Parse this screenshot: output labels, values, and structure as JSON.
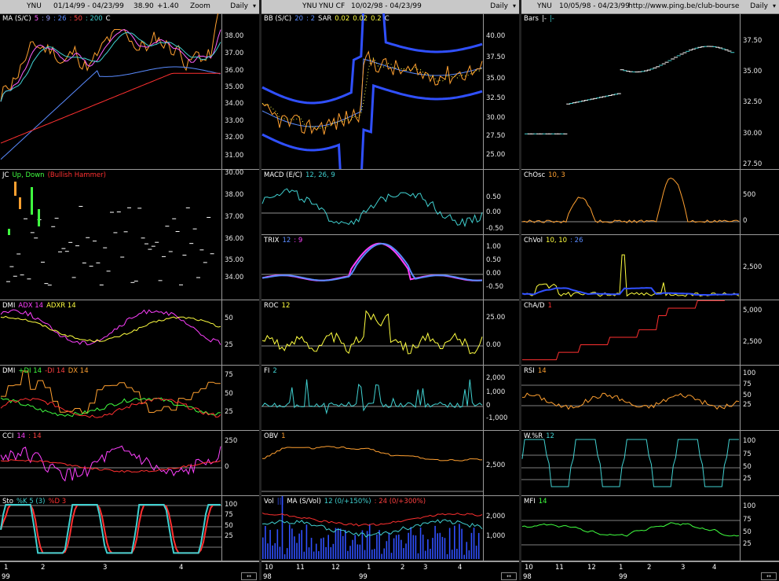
{
  "columns": [
    {
      "header": {
        "ticker": "YNU",
        "range": "01/14/99 - 04/23/99",
        "last": "38.90",
        "change": "+1.40",
        "zoom": "Zoom",
        "period": "Daily"
      },
      "panels": [
        {
          "label": [
            {
              "t": "MA (S/C)",
              "c": "#ffffff"
            },
            {
              "t": "5",
              "c": "#ff60ff"
            },
            {
              "t": ": 9",
              "c": "#9aa0ff"
            },
            {
              "t": ": 26",
              "c": "#5a8bff"
            },
            {
              "t": ": 50",
              "c": "#ff4040"
            },
            {
              "t": ": 200",
              "c": "#40d0d0"
            },
            {
              "t": "C",
              "c": "#ffffff"
            }
          ],
          "ticks": [
            "38.00",
            "37.00",
            "36.00",
            "35.00",
            "34.00",
            "33.00",
            "32.00",
            "31.00",
            "30.00"
          ]
        },
        {
          "label": [
            {
              "t": "JC",
              "c": "#ffffff"
            },
            {
              "t": "Up, Down",
              "c": "#40ff40"
            },
            {
              "t": "(Bullish Hammer)",
              "c": "#ff3030"
            }
          ],
          "ticks": [
            "38.00",
            "37.00",
            "36.00",
            "35.00",
            "34.00"
          ]
        },
        {
          "label": [
            {
              "t": "DMI",
              "c": "#ffffff"
            },
            {
              "t": "ADX 14",
              "c": "#ff40ff"
            },
            {
              "t": "ADXR 14",
              "c": "#ffff40"
            }
          ],
          "ticks": [
            "50",
            "25"
          ]
        },
        {
          "label": [
            {
              "t": "DMI",
              "c": "#ffffff"
            },
            {
              "t": "+DI 14",
              "c": "#40ff40"
            },
            {
              "t": "-DI 14",
              "c": "#ff4040"
            },
            {
              "t": "DX 14",
              "c": "#ffa030"
            }
          ],
          "ticks": [
            "75",
            "50",
            "25"
          ]
        },
        {
          "label": [
            {
              "t": "CCI",
              "c": "#ffffff"
            },
            {
              "t": "14",
              "c": "#ff40ff"
            },
            {
              "t": ": 14",
              "c": "#ff4040"
            }
          ],
          "ticks": [
            "250",
            "0"
          ]
        },
        {
          "label": [
            {
              "t": "Sto",
              "c": "#ffffff"
            },
            {
              "t": "%K 5 (3)",
              "c": "#40d0d0"
            },
            {
              "t": "%D 3",
              "c": "#ff3030"
            }
          ],
          "ticks": [
            "100",
            "75",
            "50",
            "25"
          ]
        }
      ],
      "xaxis": {
        "ticks": [
          "1",
          "2",
          "3",
          "4"
        ],
        "year": "99"
      }
    },
    {
      "header": {
        "ticker": "YNU",
        "sub": "YNU CF",
        "range": "10/02/98 - 04/23/99",
        "period": "Daily"
      },
      "panels": [
        {
          "label": [
            {
              "t": "BB (S/C)",
              "c": "#ffffff"
            },
            {
              "t": "20",
              "c": "#5a8bff"
            },
            {
              "t": ": 2",
              "c": "#5a8bff"
            },
            {
              "t": "SAR",
              "c": "#ffffff"
            },
            {
              "t": "0.02",
              "c": "#ffff40"
            },
            {
              "t": "0.02",
              "c": "#ffff40"
            },
            {
              "t": "0.2",
              "c": "#ffff40"
            },
            {
              "t": "C",
              "c": "#ffffff"
            }
          ],
          "ticks": [
            "40.00",
            "37.50",
            "35.00",
            "32.50",
            "30.00",
            "27.50",
            "25.00"
          ]
        },
        {
          "label": [
            {
              "t": "MACD (E/C)",
              "c": "#ffffff"
            },
            {
              "t": "12, 26, 9",
              "c": "#40d0d0"
            }
          ],
          "ticks": [
            "0.50",
            "0.00",
            "-0.50"
          ]
        },
        {
          "label": [
            {
              "t": "TRIX",
              "c": "#ffffff"
            },
            {
              "t": "12",
              "c": "#5a8bff"
            },
            {
              "t": ": 9",
              "c": "#ff40ff"
            }
          ],
          "ticks": [
            "1.00",
            "0.50",
            "0.00",
            "-0.50"
          ]
        },
        {
          "label": [
            {
              "t": "ROC",
              "c": "#ffffff"
            },
            {
              "t": "12",
              "c": "#ffff40"
            }
          ],
          "ticks": [
            "25.00",
            "0.00"
          ]
        },
        {
          "label": [
            {
              "t": "FI",
              "c": "#ffffff"
            },
            {
              "t": "2",
              "c": "#40d0d0"
            }
          ],
          "ticks": [
            "2,000",
            "1,000",
            "0",
            "-1,000"
          ]
        },
        {
          "label": [
            {
              "t": "OBV",
              "c": "#ffffff"
            },
            {
              "t": "1",
              "c": "#ffa030"
            }
          ],
          "ticks": [
            "2,500"
          ]
        },
        {
          "label": [
            {
              "t": "Vol",
              "c": "#ffffff"
            },
            {
              "t": "|||",
              "c": "#3050ff"
            },
            {
              "t": "MA (S/Vol)",
              "c": "#ffffff"
            },
            {
              "t": "12 (0/+150%)",
              "c": "#40d0d0"
            },
            {
              "t": ": 24 (0/+300%)",
              "c": "#ff4040"
            }
          ],
          "ticks": [
            "2,000",
            "1,000"
          ]
        }
      ],
      "xaxis": {
        "ticks": [
          "10",
          "11",
          "12",
          "1",
          "2",
          "3",
          "4"
        ],
        "year98": "98",
        "year99": "99"
      }
    },
    {
      "header": {
        "ticker": "YNU",
        "range": "10/05/98 - 04/23/99",
        "url": "http://www.ping.be/club-bourse",
        "period": "Daily"
      },
      "panels": [
        {
          "label": [
            {
              "t": "Bars",
              "c": "#ffffff"
            },
            {
              "t": "|-",
              "c": "#ffffff"
            },
            {
              "t": "|-",
              "c": "#40d0d0"
            }
          ],
          "ticks": [
            "37.50",
            "35.00",
            "32.50",
            "30.00",
            "27.50"
          ]
        },
        {
          "label": [
            {
              "t": "ChOsc",
              "c": "#ffffff"
            },
            {
              "t": "10, 3",
              "c": "#ffa030"
            }
          ],
          "ticks": [
            "500",
            "0"
          ]
        },
        {
          "label": [
            {
              "t": "ChVol",
              "c": "#ffffff"
            },
            {
              "t": "10, 10",
              "c": "#ffff40"
            },
            {
              "t": ": 26",
              "c": "#5a8bff"
            }
          ],
          "ticks": [
            "2,500"
          ]
        },
        {
          "label": [
            {
              "t": "ChA/D",
              "c": "#ffffff"
            },
            {
              "t": "1",
              "c": "#ff3030"
            }
          ],
          "ticks": [
            "5,000",
            "2,500"
          ]
        },
        {
          "label": [
            {
              "t": "RSI",
              "c": "#ffffff"
            },
            {
              "t": "14",
              "c": "#ffa030"
            }
          ],
          "ticks": [
            "100",
            "75",
            "50",
            "25"
          ]
        },
        {
          "label": [
            {
              "t": "W.%R",
              "c": "#ffffff"
            },
            {
              "t": "12",
              "c": "#40d0d0"
            }
          ],
          "ticks": [
            "100",
            "75",
            "50",
            "25"
          ]
        },
        {
          "label": [
            {
              "t": "MFI",
              "c": "#ffffff"
            },
            {
              "t": "14",
              "c": "#40ff40"
            }
          ],
          "ticks": [
            "100",
            "75",
            "50",
            "25"
          ]
        }
      ],
      "xaxis": {
        "ticks": [
          "10",
          "11",
          "12",
          "1",
          "2",
          "3",
          "4"
        ],
        "year98": "98",
        "year99": "99"
      }
    }
  ]
}
